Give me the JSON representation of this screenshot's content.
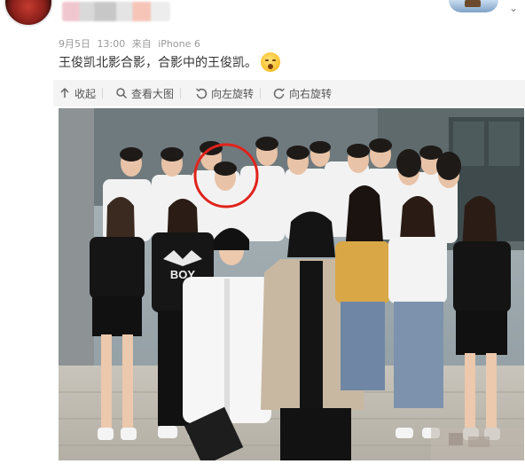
{
  "post": {
    "meta": {
      "date": "9月5日",
      "time": "13:00",
      "source_prefix": "来自",
      "device": "iPhone 6"
    },
    "text": "王俊凯北影合影，合影中的王俊凯。",
    "emoji_icon": "surprised-face-icon"
  },
  "toolbar": {
    "items": [
      {
        "label": "收起",
        "icon": "collapse-arrow-icon"
      },
      {
        "label": "查看大图",
        "icon": "magnifier-icon"
      },
      {
        "label": "向左旋转",
        "icon": "rotate-left-icon"
      },
      {
        "label": "向右旋转",
        "icon": "rotate-right-icon"
      }
    ]
  },
  "photo": {
    "shirt_text": "BOY",
    "highlight_color": "#e0231b"
  },
  "colors": {
    "accent": "#e0231b",
    "toolbar_bg": "#f4f4f4",
    "meta_text": "#9a9a9a"
  }
}
